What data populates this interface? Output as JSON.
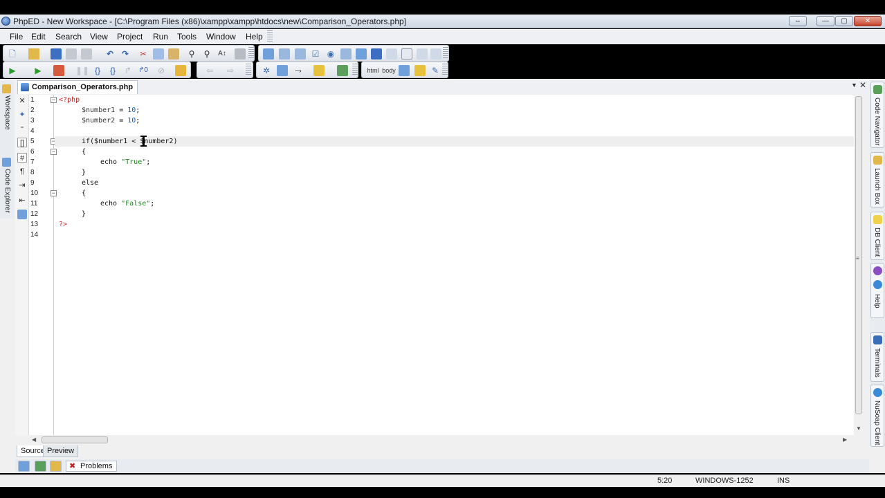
{
  "window": {
    "title": "PhpED - New Workspace - [C:\\Program Files (x86)\\xampp\\xampp\\htdocs\\new\\Comparison_Operators.php]",
    "controls": {
      "minimize": "—",
      "maximize": "▢",
      "close": "✕",
      "restore": "⇔"
    }
  },
  "menu": [
    "File",
    "Edit",
    "Search",
    "View",
    "Project",
    "Run",
    "Tools",
    "Window",
    "Help"
  ],
  "toolbar": {
    "html_label": "html",
    "body_label": "body"
  },
  "left_dock": {
    "workspace": "Workspace",
    "code_explorer": "Code Explorer"
  },
  "right_dock": [
    "Code Navigator",
    "Launch Box",
    "DB Client",
    "Help",
    "Terminals",
    "NuSoap Client"
  ],
  "editor": {
    "tab_name": "Comparison_Operators.php",
    "line_numbers": [
      "1",
      "2",
      "3",
      "4",
      "5",
      "6",
      "7",
      "8",
      "9",
      "10",
      "11",
      "12",
      "13",
      "14"
    ],
    "lines": [
      [
        "<?php"
      ],
      [
        "",
        "$number1",
        " = ",
        "10",
        ";"
      ],
      [
        "",
        "$number2",
        " = ",
        "10",
        ";"
      ],
      [],
      [
        "if($number1 < $number2)"
      ],
      [
        "{"
      ],
      [
        "echo ",
        "\"True\"",
        ";"
      ],
      [
        "}"
      ],
      [
        "else"
      ],
      [
        "{"
      ],
      [
        "echo ",
        "\"False\"",
        ";"
      ],
      [
        "}"
      ],
      [
        "?>"
      ],
      []
    ]
  },
  "bottom_tabs": {
    "source": "Source",
    "preview": "Preview"
  },
  "panel": {
    "problems": "Problems"
  },
  "status": {
    "position": "5:20",
    "encoding": "WINDOWS-1252",
    "mode": "INS"
  }
}
